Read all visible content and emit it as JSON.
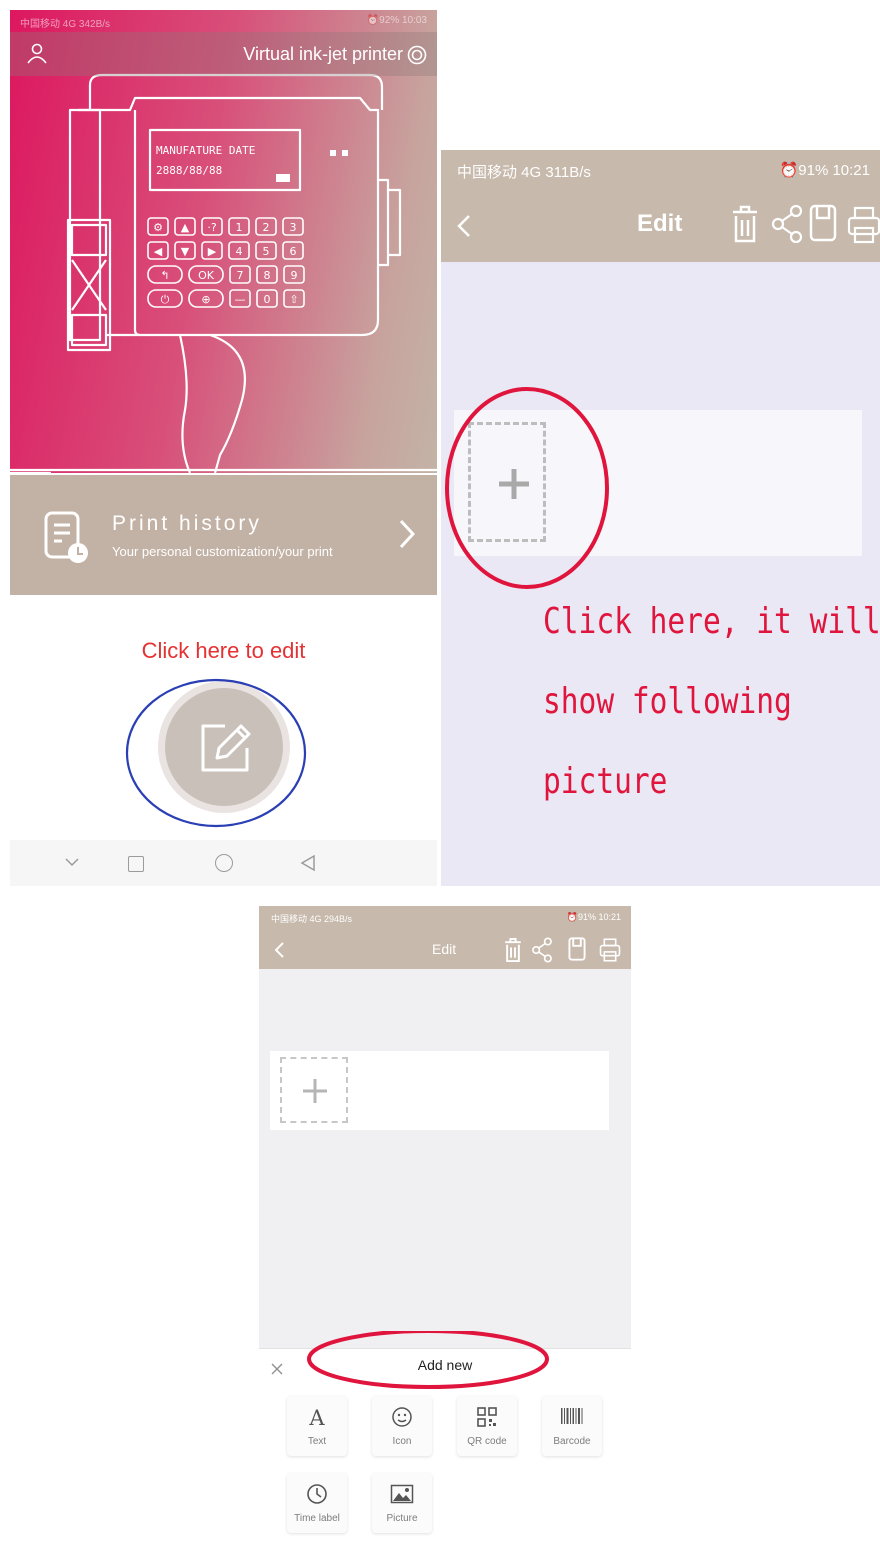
{
  "screen_home": {
    "status_left": "中国移动 4G 342B/s",
    "status_right": "⏰92% 10:03",
    "app_title": "Virtual ink-jet printer",
    "printer_display": {
      "line1": "MANUFATURE DATE",
      "line2": "2888/88/88"
    },
    "keypad": {
      "row1": [
        "⚙",
        "▲",
        "·?",
        "1",
        "2",
        "3"
      ],
      "row2": [
        "◀",
        "▼",
        "▶",
        "4",
        "5",
        "6"
      ],
      "row3": [
        "↰",
        "OK",
        "7",
        "8",
        "9"
      ],
      "row4": [
        "⏻",
        "⊕",
        "—",
        "0",
        "⇧"
      ]
    },
    "history": {
      "title": "Print history",
      "subtitle": "Your personal customization/your print"
    },
    "hint": "Click here to edit"
  },
  "screen_edit": {
    "status_left": "中国移动 4G 311B/s",
    "status_right": "⏰91% 10:21",
    "title": "Edit",
    "note_lines": [
      "Click here, it will",
      "show following",
      "picture"
    ]
  },
  "screen_add": {
    "status_left": "中国移动 4G 294B/s",
    "status_right": "⏰91% 10:21",
    "title": "Edit",
    "sheet_title": "Add new",
    "options": [
      {
        "label": "Text",
        "icon": "text-icon"
      },
      {
        "label": "Icon",
        "icon": "smiley-icon"
      },
      {
        "label": "QR code",
        "icon": "qr-code-icon"
      },
      {
        "label": "Barcode",
        "icon": "barcode-icon"
      },
      {
        "label": "Time label",
        "icon": "clock-icon"
      },
      {
        "label": "Picture",
        "icon": "picture-icon"
      }
    ]
  },
  "colors": {
    "accent_pink": "#dd175f",
    "header_taupe": "#c7b9ab",
    "annotation_red": "#e0153d",
    "annotation_blue": "#2b3fb5"
  }
}
